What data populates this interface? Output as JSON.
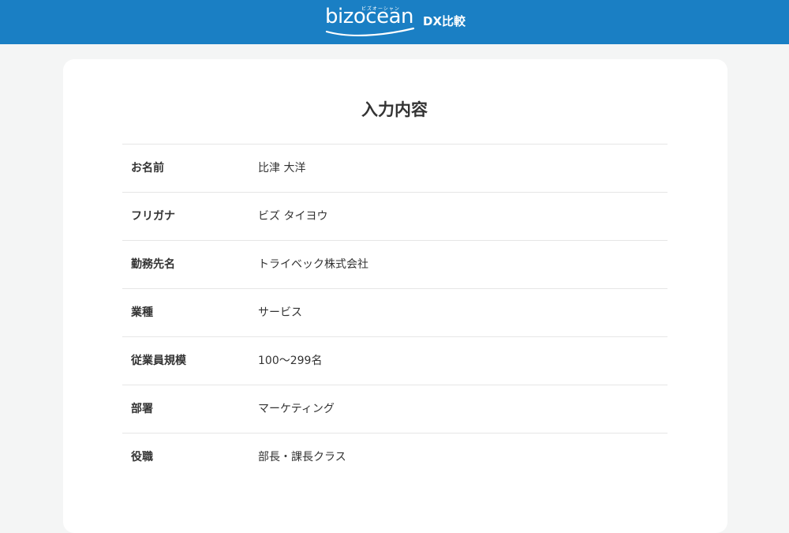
{
  "header": {
    "logo_text": "bizocean",
    "logo_kana": "ビズオーシャン",
    "sub_brand": "DX比較",
    "brand_color": "#1a7fc4"
  },
  "main": {
    "title": "入力内容",
    "rows": [
      {
        "label": "お名前",
        "value": "比津 大洋"
      },
      {
        "label": "フリガナ",
        "value": "ビズ タイヨウ"
      },
      {
        "label": "勤務先名",
        "value": "トライベック株式会社"
      },
      {
        "label": "業種",
        "value": "サービス"
      },
      {
        "label": "従業員規模",
        "value": "100〜299名"
      },
      {
        "label": "部署",
        "value": "マーケティング"
      },
      {
        "label": "役職",
        "value": "部長・課長クラス"
      }
    ]
  }
}
